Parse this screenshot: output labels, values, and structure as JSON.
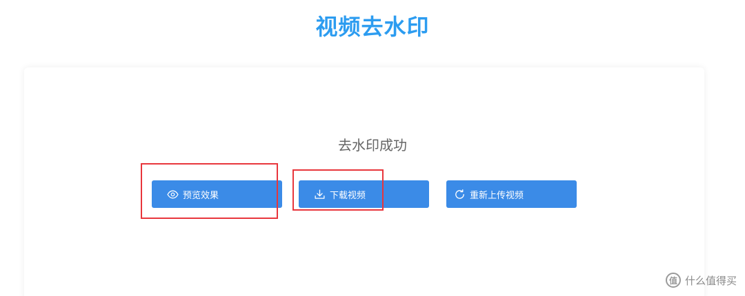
{
  "header": {
    "title": "视频去水印"
  },
  "result": {
    "status_text": "去水印成功"
  },
  "actions": {
    "preview_label": "预览效果",
    "download_label": "下载视频",
    "reupload_label": "重新上传视频"
  },
  "watermark": {
    "logo_glyph": "值",
    "text": "什么值得买"
  },
  "colors": {
    "title": "#2c9cf0",
    "button": "#3b8be7",
    "highlight": "#e8353b"
  },
  "icons": {
    "preview": "eye-icon",
    "download": "download-icon",
    "reupload": "refresh-icon"
  }
}
